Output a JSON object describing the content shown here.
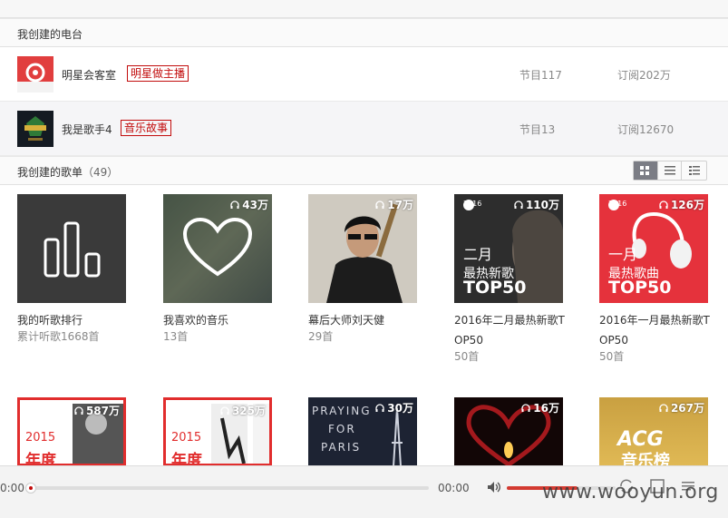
{
  "radios_section": {
    "title": "我创建的电台",
    "items": [
      {
        "name": "明星会客室",
        "tag": "明星做主播",
        "programs": "节目117",
        "subscriptions": "订阅202万"
      },
      {
        "name": "我是歌手4",
        "tag": "音乐故事",
        "programs": "节目13",
        "subscriptions": "订阅12670"
      }
    ]
  },
  "playlists_section": {
    "title": "我创建的歌单",
    "count": "（49）",
    "view_modes": [
      "grid-view-icon",
      "list-view-icon",
      "detail-list-view-icon"
    ],
    "cards": [
      {
        "title": "我的听歌排行",
        "sub": "累计听歌1668首",
        "play_count": ""
      },
      {
        "title": "我喜欢的音乐",
        "sub": "13首",
        "play_count": "43万"
      },
      {
        "title": "幕后大师刘天健",
        "sub": "29首",
        "play_count": "17万"
      },
      {
        "title": "2016年二月最热新歌TOP50",
        "sub": "50首",
        "play_count": "110万",
        "cover_text": [
          "2016",
          "二月",
          "最热新歌",
          "TOP50"
        ]
      },
      {
        "title": "2016年一月最热新歌TOP50",
        "sub": "50首",
        "play_count": "126万",
        "cover_text": [
          "2016",
          "一月",
          "最热歌曲",
          "TOP50"
        ]
      },
      {
        "title": "",
        "sub": "",
        "play_count": "587万",
        "cover_text": [
          "2015",
          "年度"
        ]
      },
      {
        "title": "",
        "sub": "",
        "play_count": "325万",
        "cover_text": [
          "2015",
          "年度"
        ]
      },
      {
        "title": "",
        "sub": "",
        "play_count": "30万",
        "cover_text": [
          "PRAYING",
          "FOR",
          "PARIS"
        ]
      },
      {
        "title": "",
        "sub": "",
        "play_count": "16万"
      },
      {
        "title": "",
        "sub": "",
        "play_count": "267万",
        "cover_text": [
          "ACG",
          "音乐榜"
        ]
      }
    ]
  },
  "player": {
    "elapsed": "0:00",
    "duration": "00:00",
    "progress": 0,
    "volume": 0.65
  },
  "watermark": "www.wooyun.org",
  "colors": {
    "accent": "#c20c0c",
    "volume": "#d33a31"
  }
}
